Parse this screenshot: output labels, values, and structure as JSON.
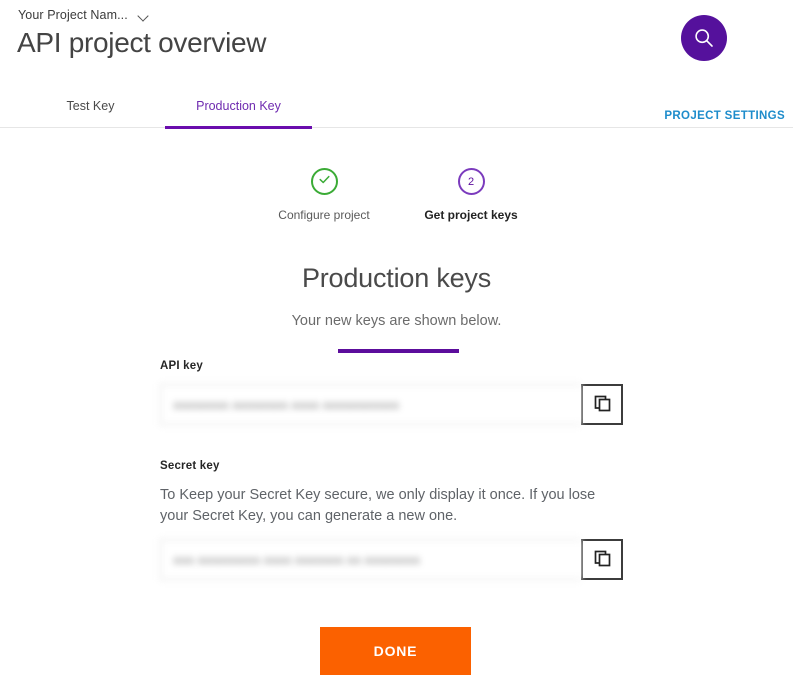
{
  "header": {
    "project_selector_label": "Your Project Nam...",
    "chevron_icon": "chevron-down-icon",
    "page_title": "API project overview",
    "search_icon": "search-icon",
    "search_accent_color": "#55119c"
  },
  "tabs": {
    "items": [
      {
        "label": "Test Key",
        "active": false
      },
      {
        "label": "Production Key",
        "active": true
      }
    ],
    "active_color": "#6a0dad",
    "project_settings_label": "PROJECT SETTINGS",
    "project_settings_color": "#1e8ccb"
  },
  "stepper": {
    "steps": [
      {
        "label": "Configure project",
        "state": "done",
        "marker": "check-icon",
        "color": "#3bab36"
      },
      {
        "label": "Get project keys",
        "state": "current",
        "marker": "2",
        "color": "#7b3bbd"
      }
    ],
    "connector_color": "#5c0d9c"
  },
  "main": {
    "title": "Production keys",
    "subtitle": "Your new keys are shown below.",
    "api_key": {
      "label": "API key",
      "value": "aaaaaaaa aaaaaaaa aaaa aaaaaaaaaaa",
      "placeholder": "",
      "copy_icon": "copy-icon"
    },
    "secret_key": {
      "label": "Secret key",
      "description": "To Keep your Secret Key secure, we only display it once. If you lose your Secret Key, you can generate a new one.",
      "value": "aaa aaaaaaaaa aaaa aaaaaaa aa aaaaaaaa",
      "placeholder": "",
      "copy_icon": "copy-icon"
    }
  },
  "footer": {
    "done_label": "DONE",
    "done_color": "#fb6100"
  }
}
